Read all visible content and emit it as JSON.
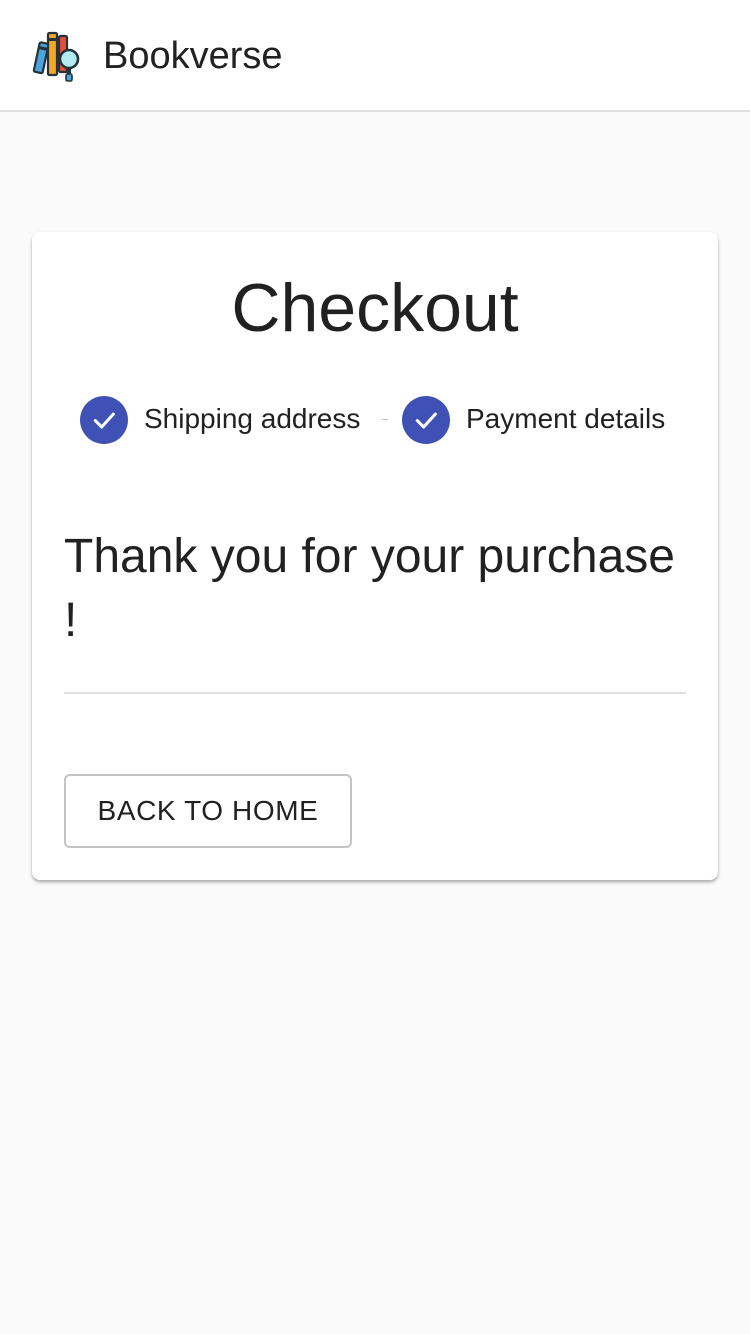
{
  "appbar": {
    "brand": "Bookverse",
    "logo_icon": "books-magnifier-icon"
  },
  "checkout": {
    "title": "Checkout",
    "steps": [
      {
        "label": "Shipping address",
        "status": "completed",
        "icon": "check-icon"
      },
      {
        "label": "Payment details",
        "status": "completed",
        "icon": "check-icon"
      }
    ],
    "message": "Thank you for your purchase !",
    "back_button_label": "BACK TO HOME"
  },
  "colors": {
    "primary": "#3f51b5",
    "background": "#fafafa",
    "surface": "#ffffff",
    "text": "#212121"
  }
}
